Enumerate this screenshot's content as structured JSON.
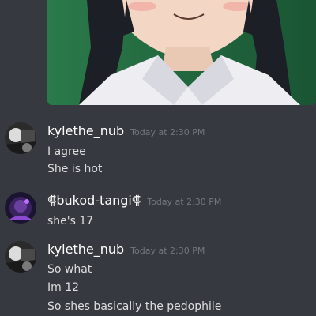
{
  "embed": {
    "type": "image",
    "content_icon": "anime-character-image"
  },
  "messages": [
    {
      "username": "kylethe_nub",
      "timestamp": "Today at 2:30 PM",
      "lines": [
        "I agree",
        "She is hot"
      ]
    },
    {
      "username": "⸿bukod-tangi⸿",
      "timestamp": "Today at 2:30 PM",
      "lines": [
        "she's 17"
      ]
    },
    {
      "username": "kylethe_nub",
      "timestamp": "Today at 2:30 PM",
      "lines": [
        "So what",
        "Im 12",
        "So shes basically the pedophile"
      ]
    }
  ],
  "colors": {
    "background": "#36393f",
    "username": "#ffffff",
    "timestamp": "#72767d",
    "message_text": "#dcddde"
  }
}
